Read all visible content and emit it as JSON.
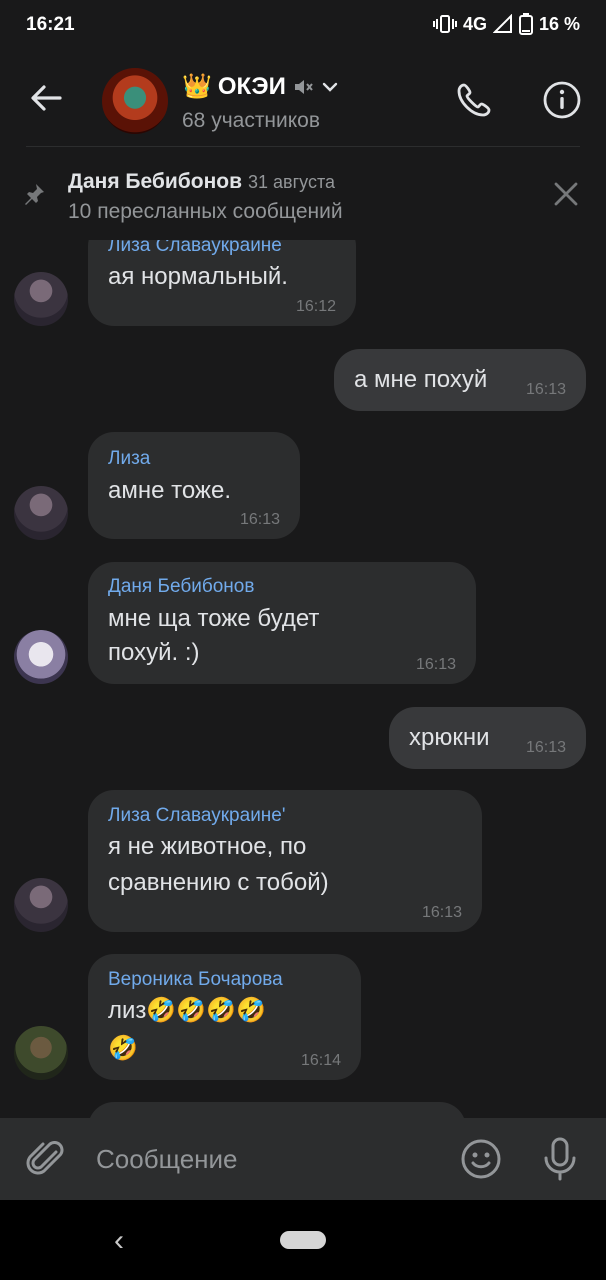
{
  "status_bar": {
    "time": "16:21",
    "network": "4G",
    "battery": "16 %"
  },
  "header": {
    "title": "ОКЭИ",
    "title_emoji": "👑",
    "subtitle": "68 участников",
    "icons": [
      "back-arrow-icon",
      "muted-icon",
      "chevron-down-icon",
      "phone-icon",
      "info-icon"
    ]
  },
  "pinned": {
    "author": "Даня Бебибонов",
    "date": "31 августа",
    "text": "10 пересланных сообщений"
  },
  "messages": [
    {
      "direction": "in",
      "sender": "Лиза Славаукраине",
      "lines": [
        "ая нормальный."
      ],
      "time": "16:12"
    },
    {
      "direction": "out",
      "sender": "",
      "lines": [
        "а мне похуй"
      ],
      "time": "16:13"
    },
    {
      "direction": "in",
      "sender": "Лиза",
      "lines": [
        "амне тоже."
      ],
      "time": "16:13"
    },
    {
      "direction": "in",
      "sender": "Даня Бебибонов",
      "lines": [
        "мне ща тоже будет",
        "похуй. :)"
      ],
      "time": "16:13"
    },
    {
      "direction": "out",
      "sender": "",
      "lines": [
        "хрюкни"
      ],
      "time": "16:13"
    },
    {
      "direction": "in",
      "sender": "Лиза Славаукраине'",
      "lines": [
        "я не животное, по",
        "сравнению с тобой)"
      ],
      "time": "16:13"
    },
    {
      "direction": "in",
      "sender": "Вероника Бочарова",
      "lines": [
        "лиз🤣🤣🤣🤣",
        "🤣"
      ],
      "time": "16:14"
    }
  ],
  "composer": {
    "placeholder": "Сообщение"
  },
  "colors": {
    "background": "#19191a",
    "bubble_in": "#2c2d2e",
    "bubble_out": "#38393b",
    "sender": "#71aaeb",
    "time": "#76787a"
  }
}
